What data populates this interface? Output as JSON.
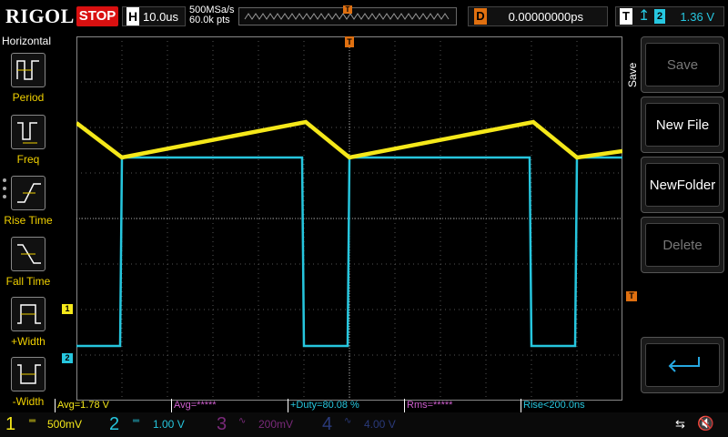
{
  "topbar": {
    "brand": "RIGOL",
    "run_state": "STOP",
    "horizontal_key": "H",
    "timebase": "10.0us",
    "sample_rate": "500MSa/s",
    "memory_points": "60.0k pts",
    "trigger_position_marker": "T",
    "delay_key": "D",
    "delay_value": "0.00000000ps",
    "trigger_key": "T",
    "trigger_edge_icon": "rising-edge-icon",
    "trigger_source": "2",
    "trigger_level": "1.36 V"
  },
  "left_menu": {
    "title": "Horizontal",
    "items": [
      {
        "label": "Period",
        "icon": "period-icon"
      },
      {
        "label": "Freq",
        "icon": "frequency-icon"
      },
      {
        "label": "Rise Time",
        "icon": "rise-time-icon"
      },
      {
        "label": "Fall Time",
        "icon": "fall-time-icon"
      },
      {
        "label": "+Width",
        "icon": "positive-width-icon"
      },
      {
        "label": "-Width",
        "icon": "negative-width-icon"
      }
    ]
  },
  "waveform": {
    "ch1_marker": "1",
    "ch2_marker": "2",
    "trigger_level_marker": "T",
    "trigger_top_marker": "T",
    "ch1_color": "#f5e81a",
    "ch2_color": "#26c6de"
  },
  "right_menu": {
    "title": "Save",
    "buttons": [
      {
        "label": "Save",
        "enabled": false
      },
      {
        "label": "New File",
        "enabled": true
      },
      {
        "label": "NewFolder",
        "enabled": true
      },
      {
        "label": "Delete",
        "enabled": false
      }
    ],
    "back_icon": "return-arrow-icon"
  },
  "measurements": [
    {
      "text": "Avg=1.78 V",
      "color": "#f5e81a"
    },
    {
      "text": "Avg=*****",
      "color": "#d060d0"
    },
    {
      "text": "+Duty=80.08 %",
      "color": "#26c6de"
    },
    {
      "text": "Rms=*****",
      "color": "#d060d0"
    },
    {
      "text": "Rise<200.0ns",
      "color": "#26c6de"
    }
  ],
  "channels": [
    {
      "num": "1",
      "scale": "500mV",
      "color": "#f5e81a",
      "active": true
    },
    {
      "num": "2",
      "scale": "1.00 V",
      "color": "#26c6de",
      "active": true
    },
    {
      "num": "3",
      "scale": "200mV",
      "color": "#7a2a7a",
      "active": false
    },
    {
      "num": "4",
      "scale": "4.00 V",
      "color": "#2a3a7a",
      "active": false
    }
  ],
  "status_icons": [
    "usb-icon",
    "speaker-muted-icon"
  ]
}
